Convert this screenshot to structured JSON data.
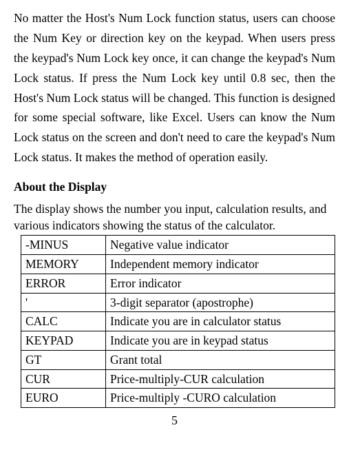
{
  "paragraph": "No matter the Host's Num Lock function status, users can choose the Num Key or direction key on the keypad. When users press the keypad's Num Lock key once, it can change the keypad's Num Lock status. If press the Num Lock key until 0.8 sec, then the Host's Num Lock status will be changed. This function is designed for some special software, like Excel. Users can know the Num Lock status on the screen and don't need to care the keypad's Num Lock status. It makes the method of operation easily.",
  "section_heading": "About the Display",
  "intro": "The display shows the number you input, calculation results, and various indicators showing the status of the calculator.",
  "table": {
    "rows": [
      {
        "k": "-MINUS",
        "v": "Negative value indicator"
      },
      {
        "k": "MEMORY",
        "v": "Independent memory indicator"
      },
      {
        "k": "ERROR",
        "v": "Error indicator"
      },
      {
        "k": "'",
        "v": "3-digit separator (apostrophe)"
      },
      {
        "k": "CALC",
        "v": "Indicate you are in calculator status"
      },
      {
        "k": "KEYPAD",
        "v": "Indicate you are in keypad status"
      },
      {
        "k": "GT",
        "v": "Grant total"
      },
      {
        "k": "CUR",
        "v": "Price-multiply-CUR calculation"
      },
      {
        "k": "EURO",
        "v": "Price-multiply -CURO calculation"
      }
    ]
  },
  "page_number": "5"
}
